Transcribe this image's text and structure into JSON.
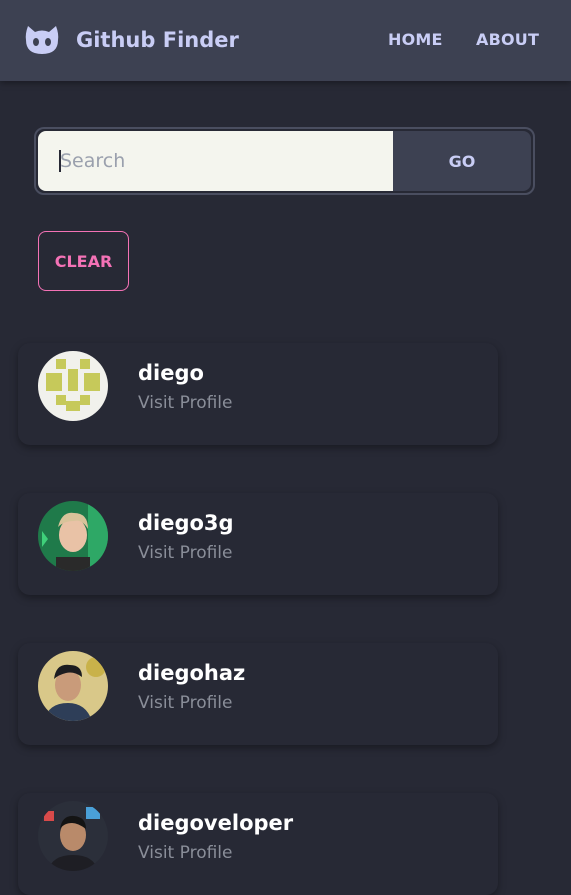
{
  "navbar": {
    "title": "Github Finder",
    "links": [
      {
        "label": "HOME"
      },
      {
        "label": "ABOUT"
      }
    ],
    "icon": "github-cat-icon",
    "color": "#c9cdf5"
  },
  "search": {
    "placeholder": "Search",
    "value": "",
    "go_label": "GO"
  },
  "clear": {
    "label": "CLEAR",
    "color": "#f472b6"
  },
  "users": [
    {
      "login": "diego",
      "link": "Visit Profile",
      "avatar": "identicon"
    },
    {
      "login": "diego3g",
      "link": "Visit Profile",
      "avatar": "photo"
    },
    {
      "login": "diegohaz",
      "link": "Visit Profile",
      "avatar": "photo"
    },
    {
      "login": "diegoveloper",
      "link": "Visit Profile",
      "avatar": "photo"
    }
  ],
  "colors": {
    "background": "#272935",
    "navbar": "#3d4152",
    "input": "#f4f5ee"
  }
}
